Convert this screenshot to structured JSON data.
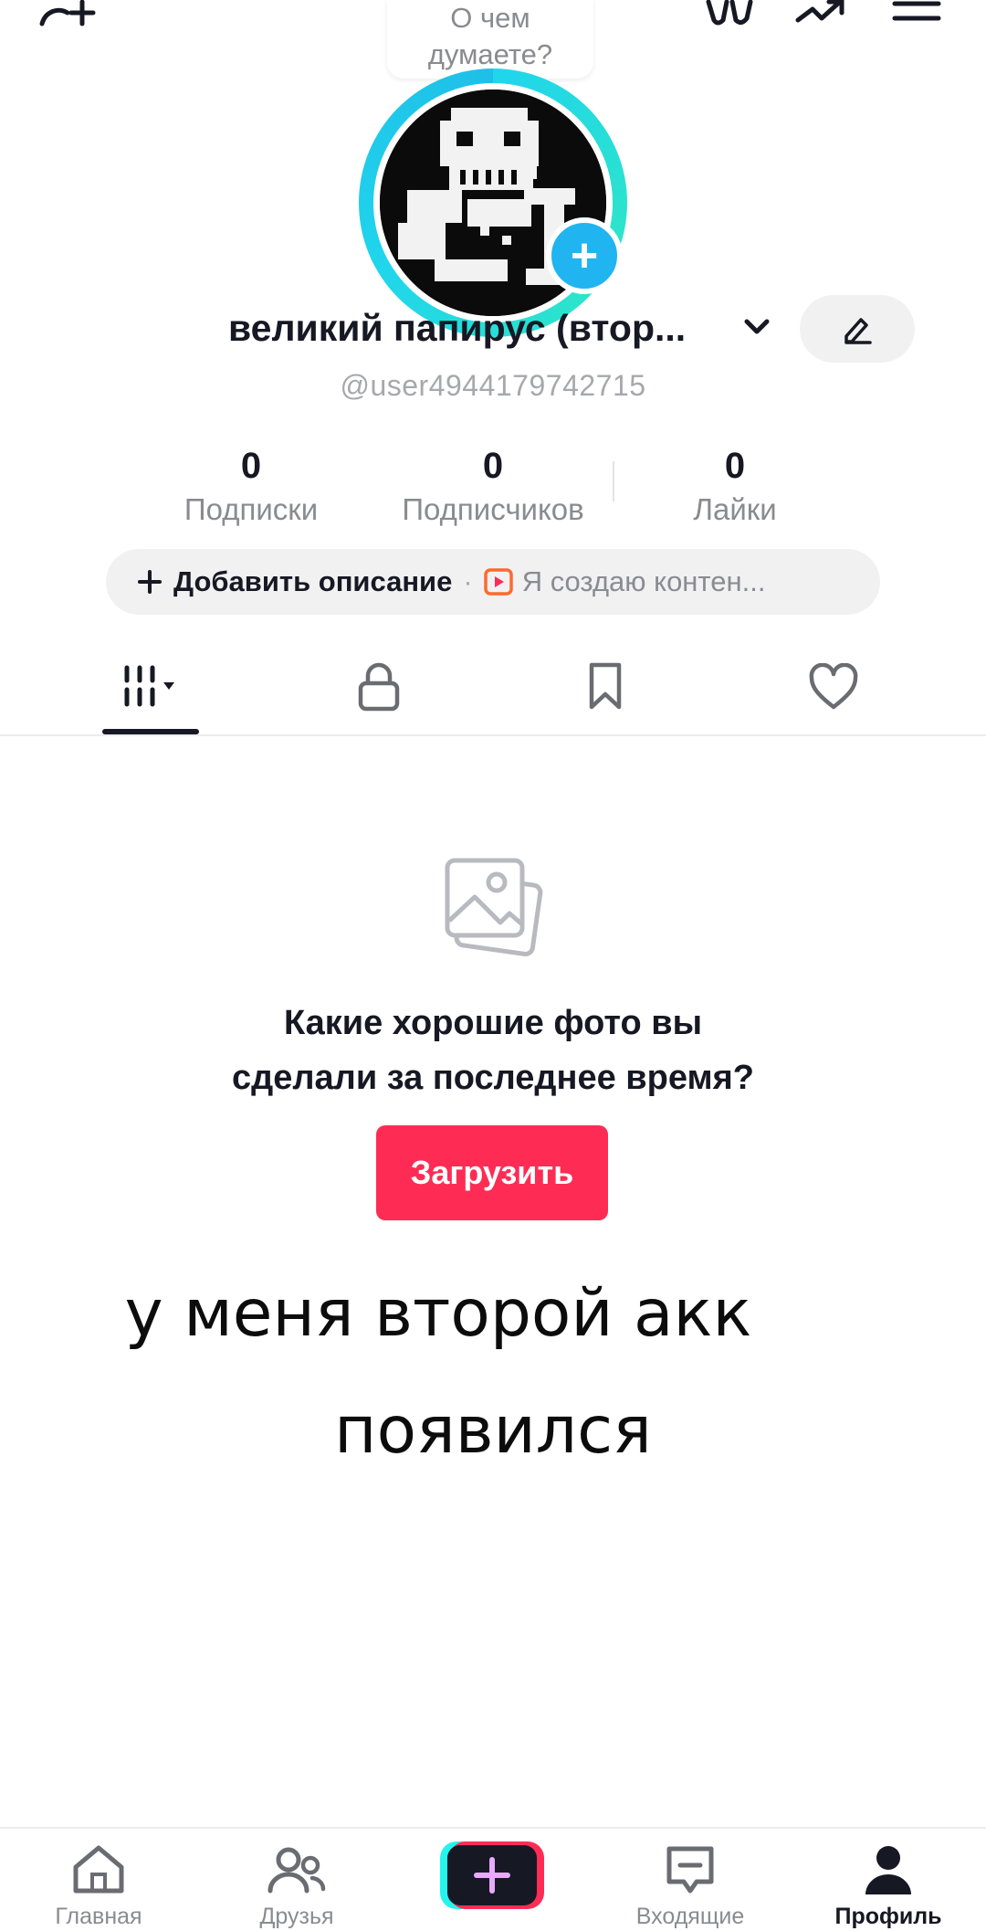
{
  "top_bubble": {
    "line1": "О чем",
    "line2": "думаете?"
  },
  "profile": {
    "name": "великий папирус (втор...",
    "handle": "@user4944179742715"
  },
  "stats": [
    {
      "value": "0",
      "label": "Подписки"
    },
    {
      "value": "0",
      "label": "Подписчиков"
    },
    {
      "value": "0",
      "label": "Лайки"
    }
  ],
  "description": {
    "add_label": "Добавить описание",
    "creator_label": "Я создаю контен..."
  },
  "tabs": [
    "videos-grid",
    "private",
    "saved",
    "liked"
  ],
  "empty_state": {
    "line1": "Какие хорошие фото вы",
    "line2": "сделали за последнее время?",
    "button": "Загрузить"
  },
  "overlay": {
    "line1": "у меня второй акк",
    "line2": "появился"
  },
  "bottom_nav": {
    "home": "Главная",
    "friends": "Друзья",
    "inbox": "Входящие",
    "profile": "Профиль"
  },
  "colors": {
    "accent": "#fe2c55",
    "ring": "#20d5ec",
    "plus_badge": "#20b5f0"
  }
}
